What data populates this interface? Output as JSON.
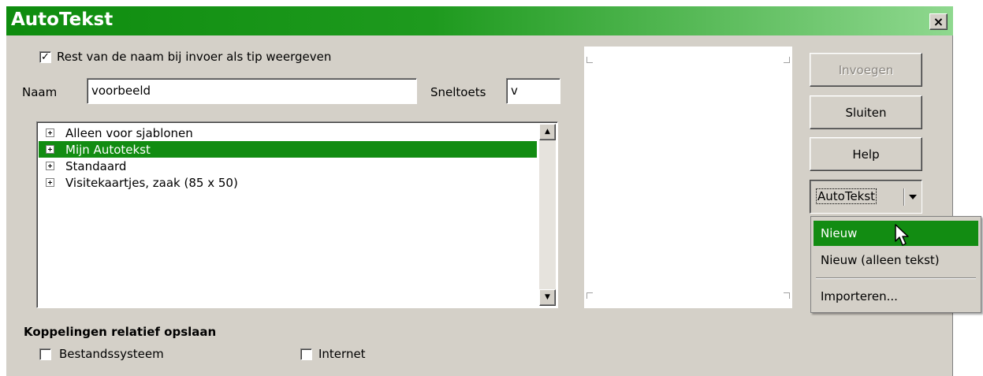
{
  "window": {
    "title": "AutoTekst",
    "close_label": "×"
  },
  "options": {
    "show_tip_checked": true,
    "show_tip_label": "Rest van de naam bij invoer als tip weergeven"
  },
  "name_field": {
    "label": "Naam",
    "value": "voorbeeld"
  },
  "shortcut_field": {
    "label": "Sneltoets",
    "value": "v"
  },
  "categories": [
    {
      "label": "Alleen voor sjablonen",
      "selected": false
    },
    {
      "label": "Mijn Autotekst",
      "selected": true
    },
    {
      "label": "Standaard",
      "selected": false
    },
    {
      "label": "Visitekaartjes, zaak (85 x 50)",
      "selected": false
    }
  ],
  "buttons": {
    "insert": "Invoegen",
    "close": "Sluiten",
    "help": "Help",
    "autotext": "AutoTekst"
  },
  "autotext_menu": {
    "items": [
      {
        "label": "Nieuw",
        "selected": true
      },
      {
        "label": "Nieuw (alleen tekst)",
        "selected": false
      },
      {
        "label": "Importeren...",
        "selected": false
      }
    ]
  },
  "links_section": {
    "title": "Koppelingen relatief opslaan",
    "filesystem": {
      "label": "Bestandssysteem",
      "checked": false
    },
    "internet": {
      "label": "Internet",
      "checked": false
    }
  },
  "colors": {
    "title_bar": "#0e8c0e",
    "selection": "#128c12",
    "dialog_bg": "#d4d0c8"
  }
}
